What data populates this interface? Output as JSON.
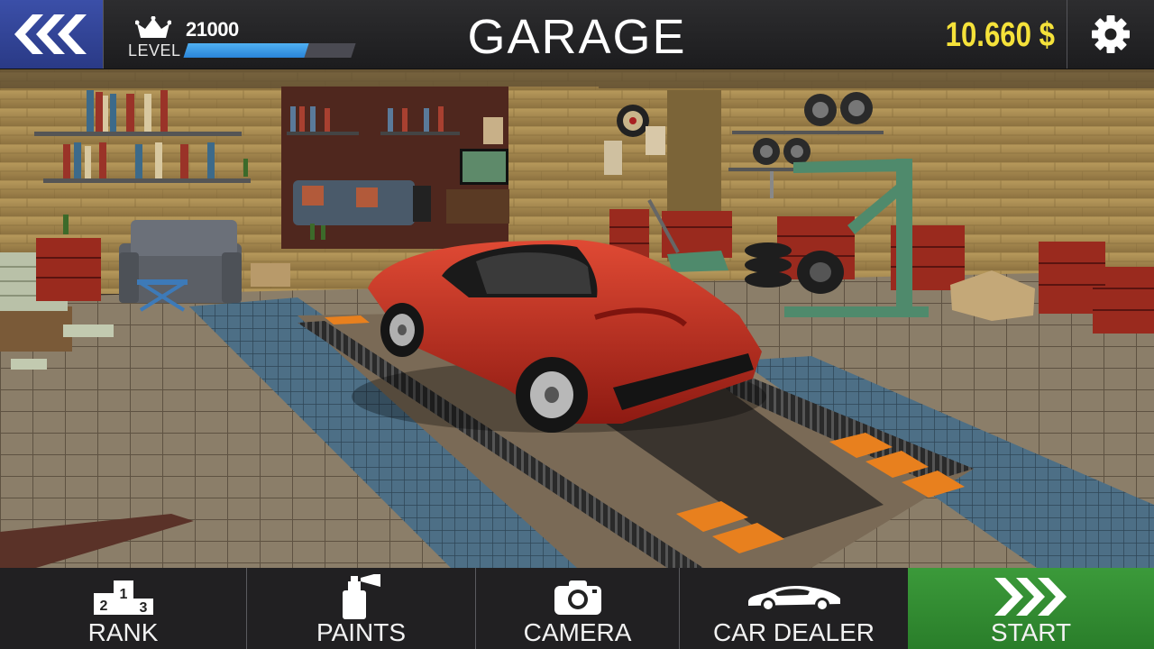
{
  "header": {
    "title": "GARAGE",
    "level_label": "LEVEL",
    "level_value": "21000",
    "level_progress": 0.72,
    "money": "10.660 $"
  },
  "icons": {
    "back": "triple-chevron-left-icon",
    "level": "crown-icon",
    "settings": "gear-icon"
  },
  "bottom_nav": {
    "rank": {
      "label": "RANK",
      "icon": "podium-icon"
    },
    "paints": {
      "label": "PAINTS",
      "icon": "spray-can-icon"
    },
    "camera": {
      "label": "CAMERA",
      "icon": "camera-icon"
    },
    "car_dealer": {
      "label": "CAR DEALER",
      "icon": "car-icon"
    },
    "start": {
      "label": "START",
      "icon": "triple-chevron-right-icon"
    }
  },
  "podium_numbers": [
    "2",
    "1",
    "3"
  ],
  "colors": {
    "back_button": "#2f42a0",
    "money": "#f5e23a",
    "level_bar": "#3a9be6",
    "start_button": "#349034",
    "car": "#c42a1e"
  }
}
